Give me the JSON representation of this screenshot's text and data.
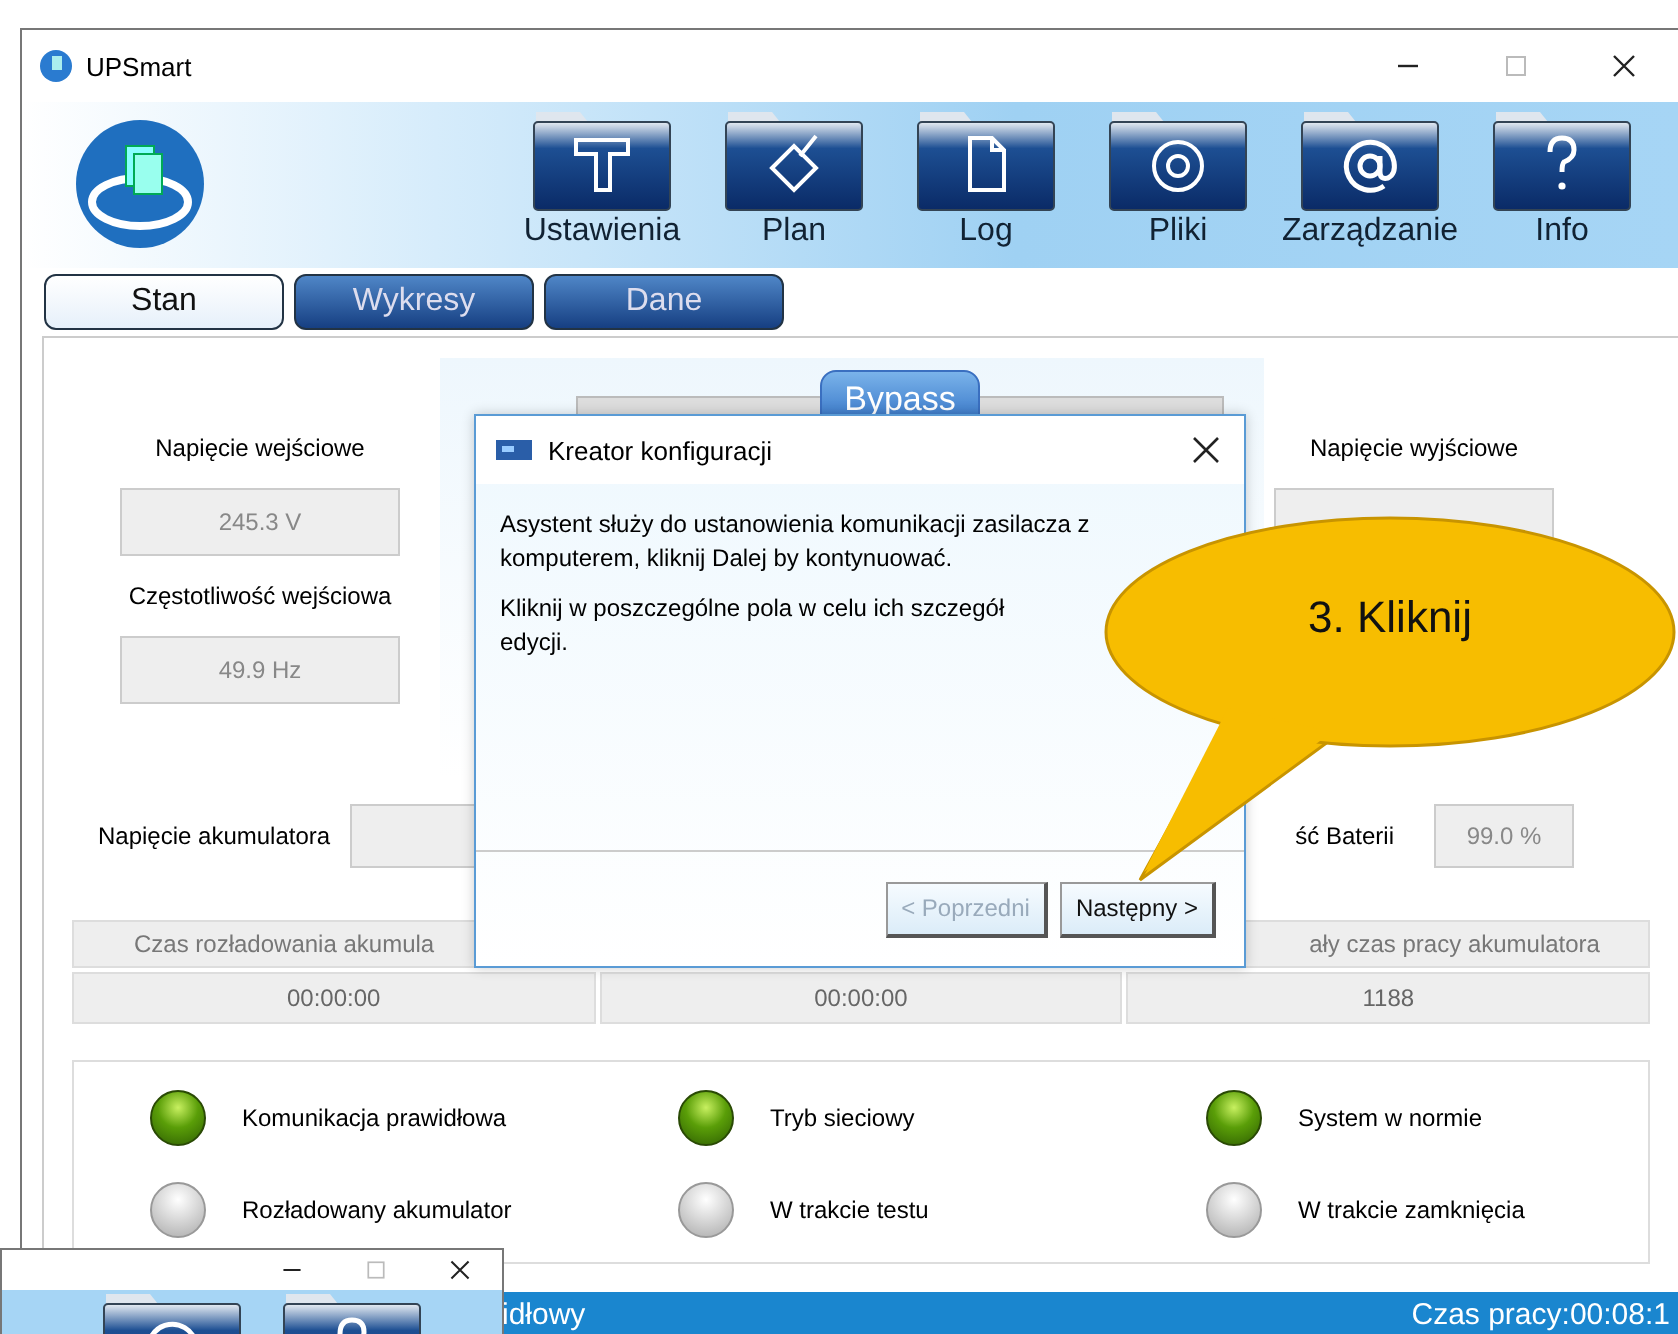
{
  "window": {
    "title": "UPSmart"
  },
  "toolbar": [
    {
      "label": "Ustawienia",
      "kind": "hammer"
    },
    {
      "label": "Plan",
      "kind": "pencil"
    },
    {
      "label": "Log",
      "kind": "document"
    },
    {
      "label": "Pliki",
      "kind": "disc"
    },
    {
      "label": "Zarządzanie",
      "kind": "at"
    },
    {
      "label": "Info",
      "kind": "question"
    }
  ],
  "tabs": [
    {
      "label": "Stan",
      "selected": true
    },
    {
      "label": "Wykresy",
      "selected": false
    },
    {
      "label": "Dane",
      "selected": false
    }
  ],
  "diagram": {
    "bypass_button": "Bypass"
  },
  "input": {
    "voltage_label": "Napięcie wejściowe",
    "voltage": "245.3 V",
    "frequency_label": "Częstotliwość wejściowa",
    "frequency": "49.9 Hz"
  },
  "output": {
    "voltage_label": "Napięcie wyjściowe"
  },
  "battery": {
    "voltage_label": "Napięcie akumulatora",
    "capacity_label": "ść Baterii",
    "capacity": "99.0 %"
  },
  "times": [
    {
      "header": "Czas rozładowania akumula",
      "value": "00:00:00"
    },
    {
      "value": "00:00:00"
    },
    {
      "header": "ały czas pracy akumulatora",
      "value": "1188"
    }
  ],
  "indicators": [
    {
      "label": "Komunikacja prawidłowa",
      "on": true
    },
    {
      "label": "Tryb sieciowy",
      "on": true
    },
    {
      "label": "System w normie",
      "on": true
    },
    {
      "label": "Rozładowany akumulator",
      "on": false
    },
    {
      "label": "W trakcie testu",
      "on": false
    },
    {
      "label": "W trakcie zamknięcia",
      "on": false
    }
  ],
  "status_bar": {
    "left": "idłowy",
    "right": "Czas pracy:00:08:1"
  },
  "dialog": {
    "title": "Kreator konfiguracji",
    "paragraphs": [
      [
        "Asystent służy do ustanowienia komunikacji zasilacza z komputerem, kliknij Dalej by kontynuować."
      ],
      [
        "Kliknij w poszczególne pola w celu ich szczegół",
        "edycji."
      ]
    ],
    "buttons": [
      {
        "label": "< Poprzedni",
        "disabled": true
      },
      {
        "label": "Następny >",
        "disabled": false
      }
    ]
  },
  "callout": {
    "text": "3. Kliknij"
  }
}
